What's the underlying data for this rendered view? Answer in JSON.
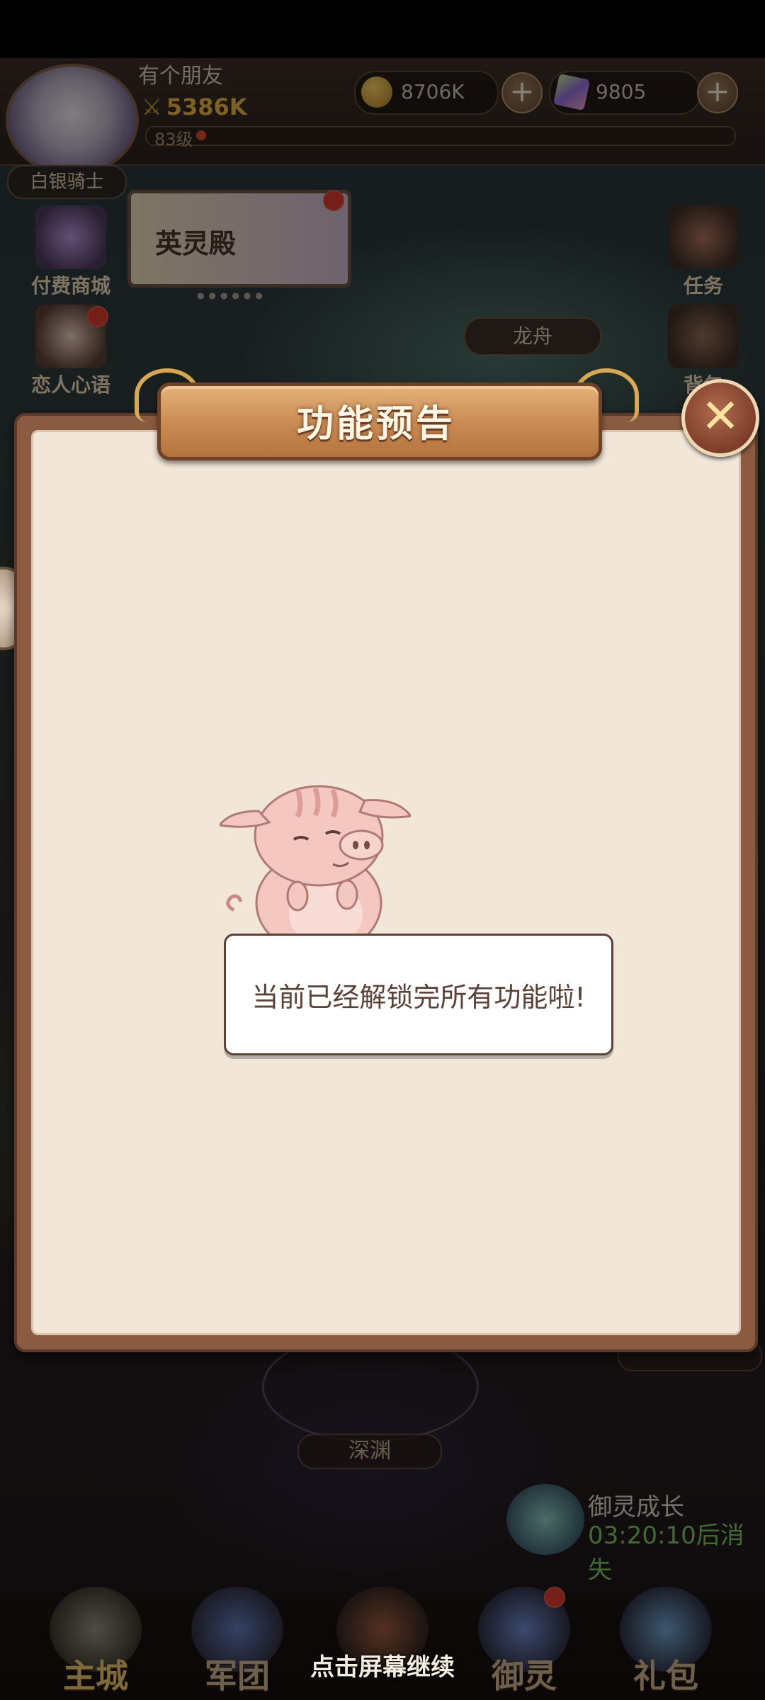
{
  "player": {
    "name": "有个朋友",
    "power": "5386K",
    "level": "83级",
    "rank": "白银骑士"
  },
  "currency": {
    "gold": "8706K",
    "gems": "9805"
  },
  "side_menu": {
    "paid_shop": "付费商城",
    "love_words": "恋人心语",
    "task": "任务",
    "bag": "背包"
  },
  "banner": {
    "hall": "英灵殿"
  },
  "map": {
    "dragon_boat": "龙舟",
    "abyss": "深渊"
  },
  "event": {
    "title": "御灵成长",
    "timer": "03:20:10后消失"
  },
  "bottom_nav": {
    "main_city": "主城",
    "legion": "军团",
    "spirit": "御灵",
    "gift": "礼包"
  },
  "modal": {
    "title": "功能预告",
    "message": "当前已经解锁完所有功能啦!",
    "continue_hint": "点击屏幕继续"
  },
  "icons": {
    "close": "close-icon",
    "pig": "pig-icon",
    "plus": "plus-icon",
    "coin": "coin-icon",
    "gem": "gem-icon"
  },
  "colors": {
    "modal_frame": "#8a5a41",
    "modal_panel": "#f2e6d8",
    "title_plaque": "#c98a52",
    "message_text": "#5a4236",
    "timer_green": "#7bbf5c"
  }
}
